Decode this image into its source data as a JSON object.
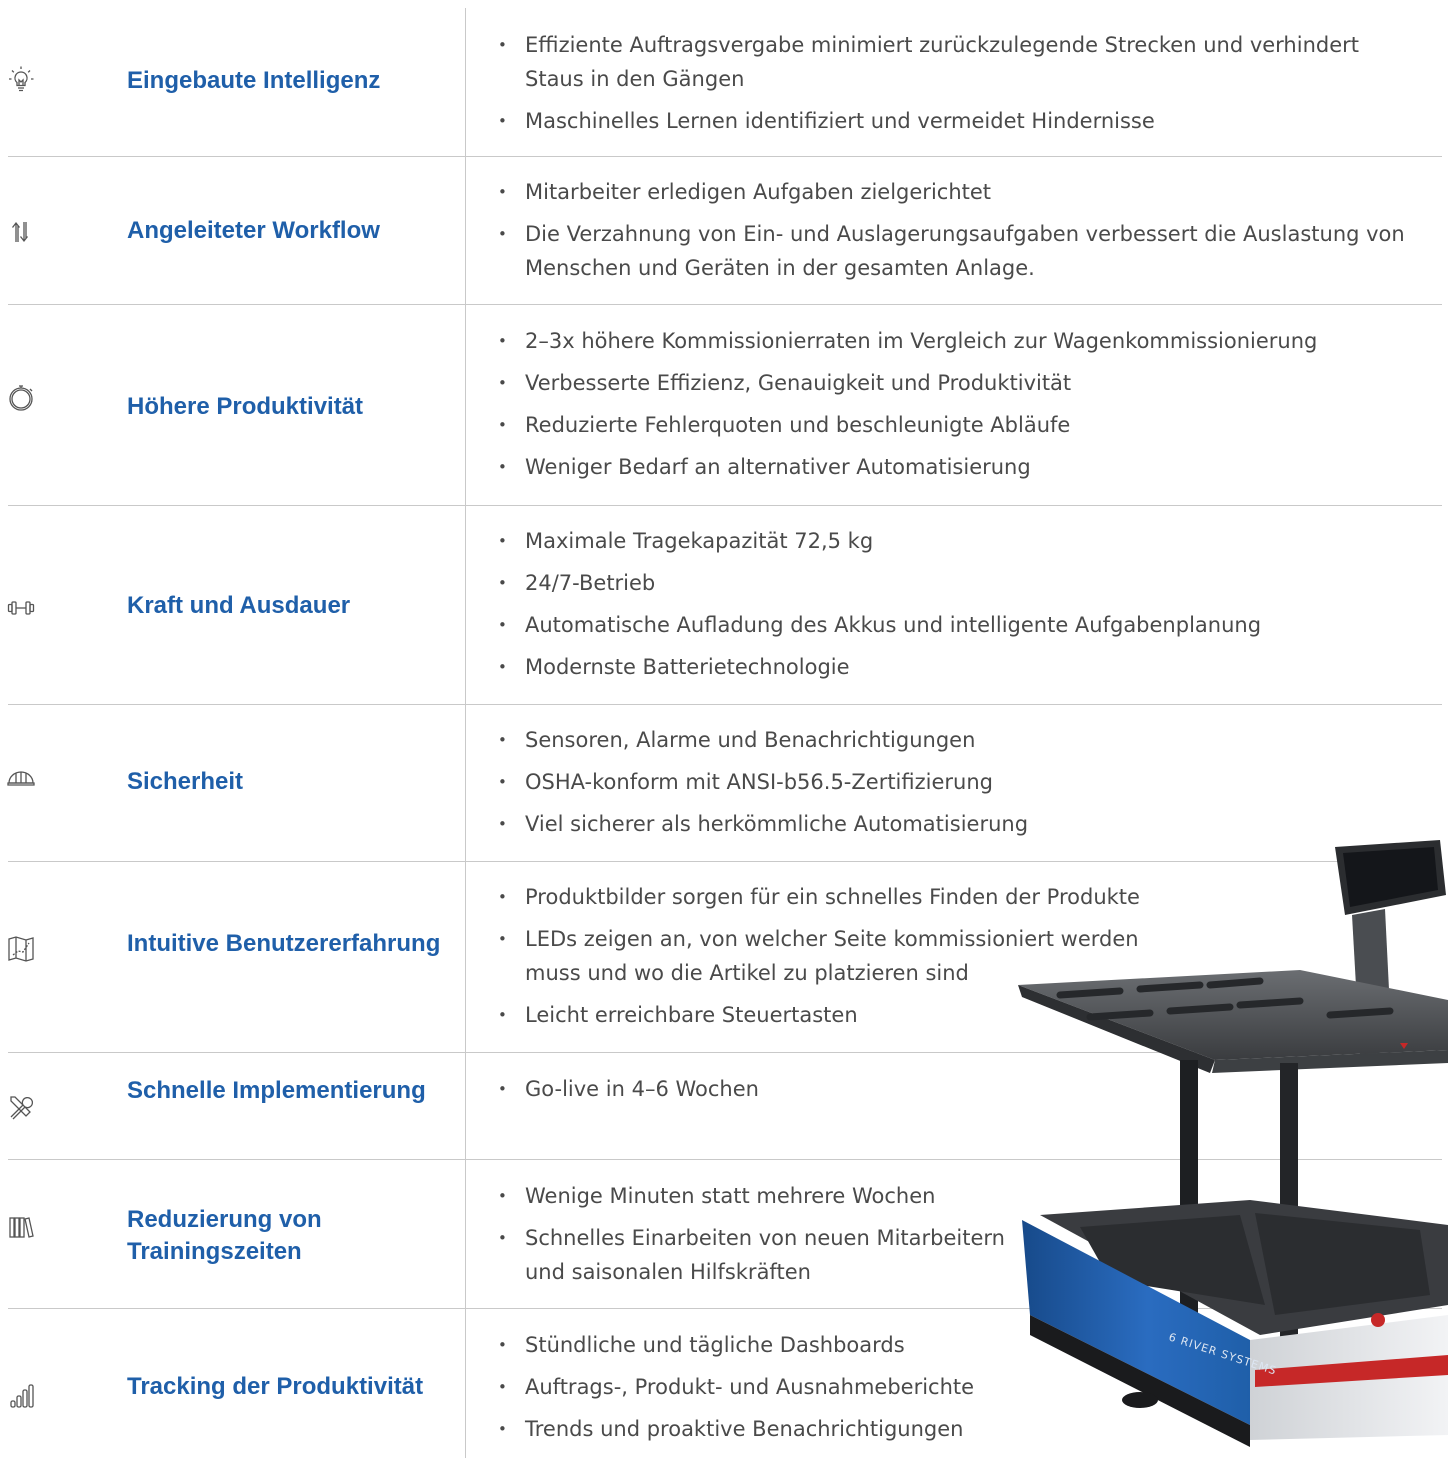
{
  "rows": [
    {
      "icon": "lightbulb-icon",
      "title": "Eingebaute Intelligenz",
      "bullets": [
        "Effiziente Auftragsvergabe minimiert zurückzulegende Strecken und verhindert Staus in den Gängen",
        "Maschinelles Lernen identifiziert und vermeidet Hindernisse"
      ]
    },
    {
      "icon": "up-down-arrows-icon",
      "title": "Angeleiteter Workflow",
      "bullets": [
        "Mitarbeiter erledigen Aufgaben zielgerichtet",
        "Die Verzahnung von Ein- und Auslagerungsaufgaben verbessert die Auslastung von Menschen und Geräten in der gesamten Anlage."
      ]
    },
    {
      "icon": "stopwatch-icon",
      "title": "Höhere Produktivität",
      "bullets": [
        "2–3x höhere Kommissionierraten im Vergleich zur Wagenkommissionierung",
        "Verbesserte Effizienz, Genauigkeit und Produktivität",
        "Reduzierte Fehlerquoten und beschleunigte Abläufe",
        "Weniger Bedarf an alternativer Automatisierung"
      ]
    },
    {
      "icon": "dumbbell-icon",
      "title": "Kraft und Ausdauer",
      "bullets": [
        "Maximale Tragekapazität 72,5 kg",
        "24/7-Betrieb",
        "Automatische Aufladung des Akkus und intelligente Aufgabenplanung",
        "Modernste Batterietechnologie"
      ]
    },
    {
      "icon": "hard-hat-icon",
      "title": "Sicherheit",
      "bullets": [
        "Sensoren, Alarme und Benachrichtigungen",
        "OSHA-konform mit ANSI-b56.5-Zertifizierung",
        " Viel sicherer als herkömmliche Automatisierung"
      ]
    },
    {
      "icon": "map-route-icon",
      "title": "Intuitive Benutzererfahrung",
      "bullets": [
        "Produktbilder sorgen für ein schnelles Finden der Produkte",
        "LEDs zeigen an, von welcher Seite kommissioniert werden muss und wo die Artikel zu platzieren sind",
        "Leicht erreichbare Steuertasten"
      ]
    },
    {
      "icon": "tools-icon",
      "title": "Schnelle Implementierung",
      "bullets": [
        "Go-live in 4–6 Wochen"
      ]
    },
    {
      "icon": "books-icon",
      "title": "Reduzierung von Trainingszeiten",
      "bullets": [
        "Wenige Minuten statt mehrere Wochen",
        " Schnelles Einarbeiten von neuen Mitarbeitern und saisonalen Hilfskräften"
      ]
    },
    {
      "icon": "bar-chart-icon",
      "title": "Tracking der Produktivität",
      "bullets": [
        "Stündliche und tägliche Dashboards",
        "Auftrags-, Produkt- und Ausnahmeberichte",
        "Trends und proaktive Benachrichtigungen"
      ]
    }
  ],
  "robot": {
    "logo_text": "6 RIVER SYSTEMS",
    "body_color": "#1f5fa9",
    "accent_color": "#c62828"
  }
}
